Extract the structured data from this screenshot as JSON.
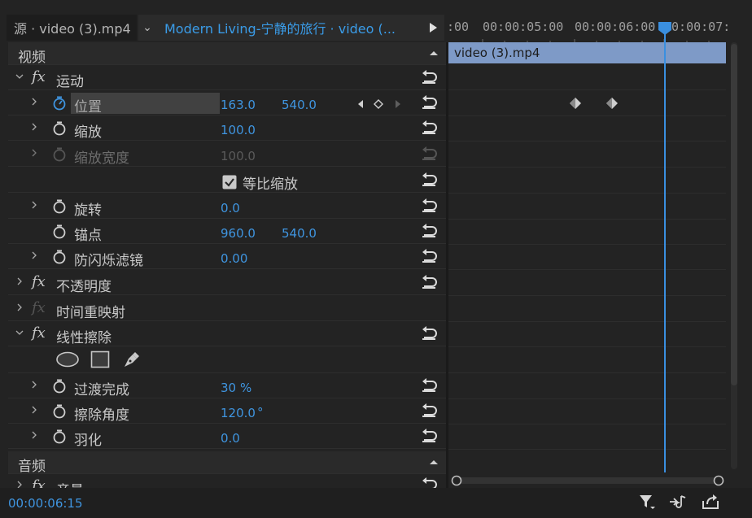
{
  "tabs": {
    "source_tab": "源 · video (3).mp4",
    "sequence_tab": "Modern  Living-宁静的旅行 · video (..."
  },
  "ruler": {
    "labels": [
      ":00",
      "00:00:05:00",
      "00:00:06:00",
      "00:00:07:"
    ]
  },
  "clip": {
    "name": "video (3).mp4"
  },
  "sections": {
    "video": "视频",
    "audio": "音频"
  },
  "effects": {
    "motion": "运动",
    "position": {
      "label": "位置",
      "x": "163.0",
      "y": "540.0"
    },
    "scale": {
      "label": "缩放",
      "value": "100.0"
    },
    "scale_width": {
      "label": "缩放宽度",
      "value": "100.0"
    },
    "uniform_scale": {
      "label": "等比缩放",
      "checked": true
    },
    "rotation": {
      "label": "旋转",
      "value": "0.0"
    },
    "anchor": {
      "label": "锚点",
      "x": "960.0",
      "y": "540.0"
    },
    "anti_flicker": {
      "label": "防闪烁滤镜",
      "value": "0.00"
    },
    "opacity": "不透明度",
    "time_remap": "时间重映射",
    "linear_wipe": "线性擦除",
    "transition_completion": {
      "label": "过渡完成",
      "value": "30",
      "unit": "%"
    },
    "wipe_angle": {
      "label": "擦除角度",
      "value": "120.0",
      "unit": "°"
    },
    "feather": {
      "label": "羽化",
      "value": "0.0"
    },
    "volume": "音量"
  },
  "footer": {
    "timecode": "00:00:06:15"
  },
  "colors": {
    "accent": "#3f95e0",
    "clip": "#7e9ac7",
    "background": "#232323"
  },
  "icons": [
    "stopwatch-icon",
    "reset-icon",
    "keyframe-icon",
    "ellipse-mask-icon",
    "rect-mask-icon",
    "pen-mask-icon",
    "filter-icon",
    "audio-icon",
    "export-icon"
  ]
}
